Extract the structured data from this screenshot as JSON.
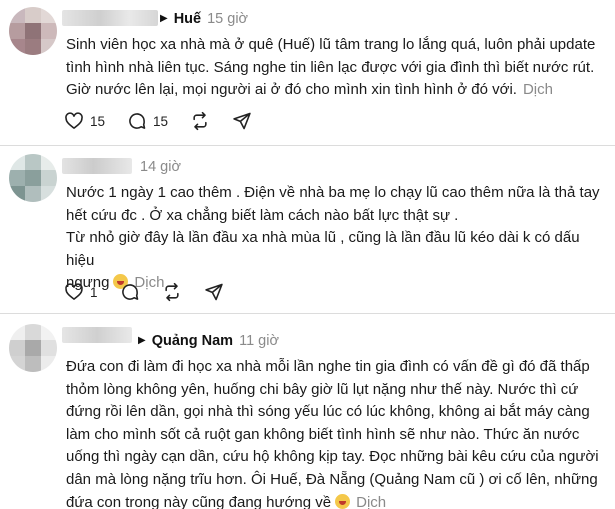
{
  "posts": [
    {
      "location": "Huế",
      "time": "15 giờ",
      "lines": [
        "Sinh viên học xa nhà mà ở quê (Huế) lũ tâm trang lo lắng quá, luôn phải update",
        "tình hình nhà liên tục. Sáng nghe tin liên lạc được với gia đình thì biết nước rút.",
        "Giờ nước lên lại, mọi người ai ở đó cho mình xin tình hình ở đó với."
      ],
      "translate": "Dịch",
      "likes": "15",
      "comments": "15"
    },
    {
      "time": "14 giờ",
      "lines": [
        "Nước 1 ngày 1 cao thêm . Điện về nhà ba mẹ lo chạy lũ cao thêm nữa là thả tay",
        "hết cứu đc . Ở xa chẳng biết làm cách nào bất lực thật sự .",
        "Từ nhỏ giờ đây là lần đầu xa nhà mùa lũ , cũng là lần đầu lũ kéo dài k có dấu hiệu",
        "ngưng"
      ],
      "translate": "Dịch",
      "likes": "1"
    },
    {
      "location": "Quảng Nam",
      "time": "11 giờ",
      "lines": [
        "Đứa con đi làm đi học xa nhà mỗi lần nghe tin gia đình có vấn đề gì đó đã thấp",
        "thỏm lòng không yên, huống chi bây giờ lũ lụt nặng như thế này. Nước thì cứ",
        "đứng rồi lên dần, gọi nhà thì sóng yếu lúc có lúc không, không ai bắt máy càng",
        "làm cho mình sốt cả ruột gan không biết tình hình sẽ như nào. Thức ăn nước",
        "uống thì ngày cạn dần, cứu hộ không kịp tay. Đọc những bài kêu cứu của người",
        "dân mà lòng nặng trĩu hơn. Ôi Huế, Đà Nẵng (Quảng Nam cũ ) ơi cố lên, những",
        "đứa con trong này cũng đang hướng về"
      ],
      "translate": "Dịch"
    }
  ],
  "icons": {
    "like": "heart-icon",
    "comment": "comment-icon",
    "repost": "repost-icon",
    "share": "send-icon",
    "emoji": "crying-face-emoji-icon"
  }
}
